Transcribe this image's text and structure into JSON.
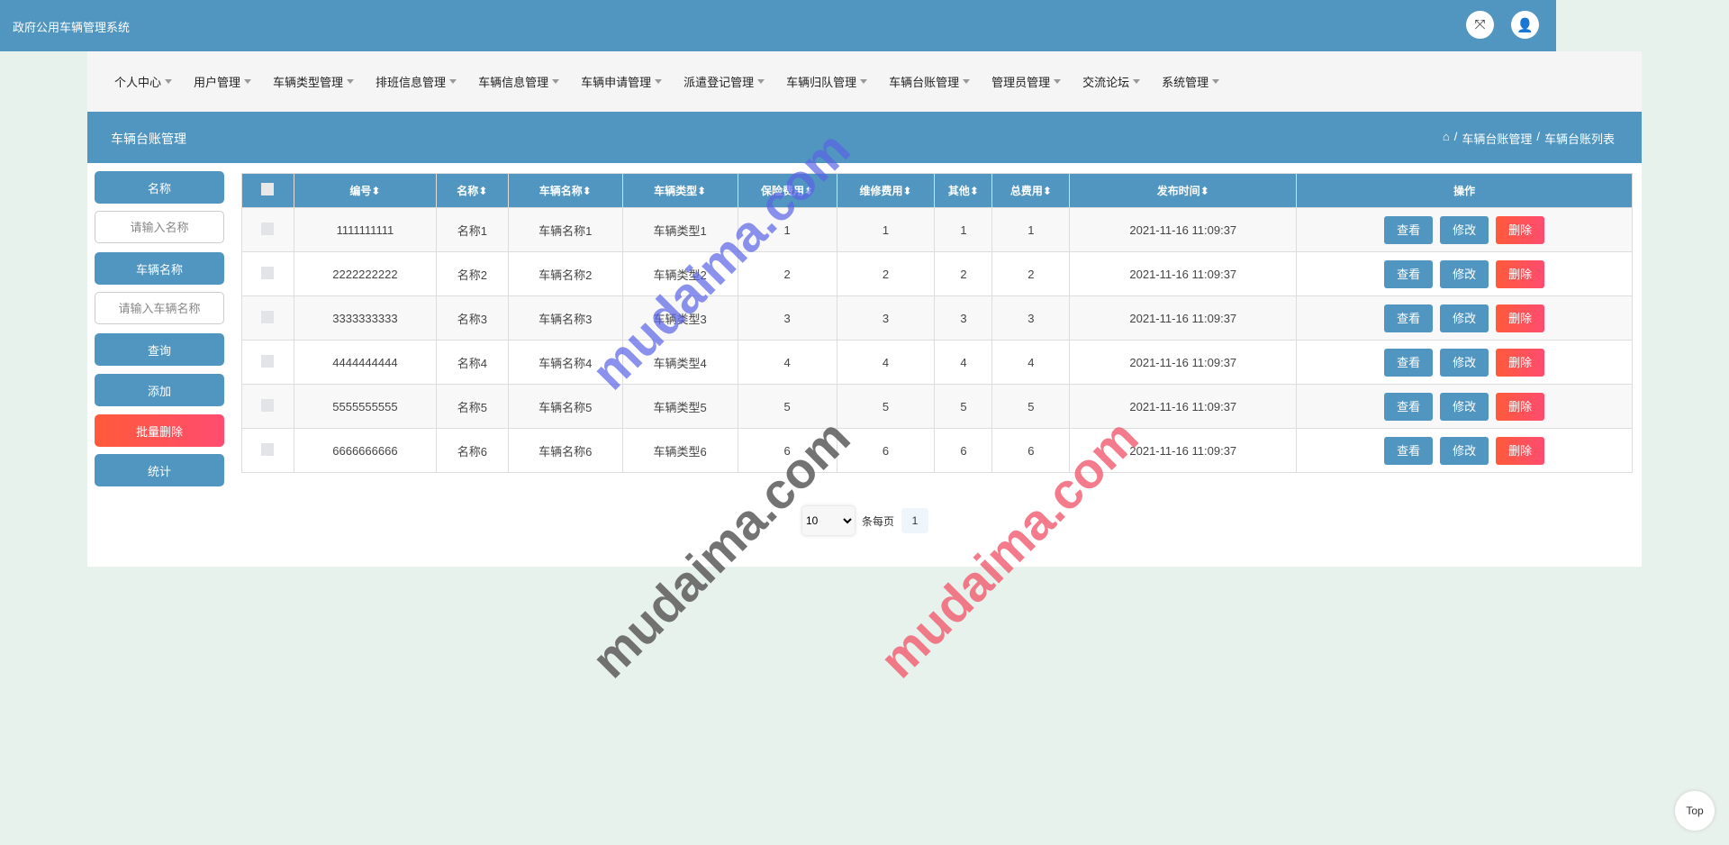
{
  "header": {
    "title": "政府公用车辆管理系统",
    "icons": [
      "fullscreen-icon",
      "user-icon"
    ]
  },
  "nav": [
    "个人中心",
    "用户管理",
    "车辆类型管理",
    "排班信息管理",
    "车辆信息管理",
    "车辆申请管理",
    "派遣登记管理",
    "车辆归队管理",
    "车辆台账管理",
    "管理员管理",
    "交流论坛",
    "系统管理"
  ],
  "section": {
    "title": "车辆台账管理",
    "breadcrumb": [
      "车辆台账管理",
      "车辆台账列表"
    ]
  },
  "search": {
    "name_label": "名称",
    "name_placeholder": "请输入名称",
    "vehicle_label": "车辆名称",
    "vehicle_placeholder": "请输入车辆名称",
    "query": "查询",
    "add": "添加",
    "batch_delete": "批量删除",
    "stats": "统计"
  },
  "table": {
    "columns": [
      "编号",
      "名称",
      "车辆名称",
      "车辆类型",
      "保险费用",
      "维修费用",
      "其他",
      "总费用",
      "发布时间",
      "操作"
    ],
    "rows": [
      [
        "1111111111",
        "名称1",
        "车辆名称1",
        "车辆类型1",
        "1",
        "1",
        "1",
        "1",
        "2021-11-16 11:09:37"
      ],
      [
        "2222222222",
        "名称2",
        "车辆名称2",
        "车辆类型2",
        "2",
        "2",
        "2",
        "2",
        "2021-11-16 11:09:37"
      ],
      [
        "3333333333",
        "名称3",
        "车辆名称3",
        "车辆类型3",
        "3",
        "3",
        "3",
        "3",
        "2021-11-16 11:09:37"
      ],
      [
        "4444444444",
        "名称4",
        "车辆名称4",
        "车辆类型4",
        "4",
        "4",
        "4",
        "4",
        "2021-11-16 11:09:37"
      ],
      [
        "5555555555",
        "名称5",
        "车辆名称5",
        "车辆类型5",
        "5",
        "5",
        "5",
        "5",
        "2021-11-16 11:09:37"
      ],
      [
        "6666666666",
        "名称6",
        "车辆名称6",
        "车辆类型6",
        "6",
        "6",
        "6",
        "6",
        "2021-11-16 11:09:37"
      ]
    ],
    "actions": {
      "view": "查看",
      "edit": "修改",
      "delete": "删除"
    }
  },
  "pagination": {
    "page_size": "10",
    "per_page_label": "条每页",
    "current_page": "1"
  },
  "top_button": "Top",
  "watermark": "mudaima.com",
  "colors": {
    "primary": "#5096c0",
    "danger": "#ff4c70"
  }
}
